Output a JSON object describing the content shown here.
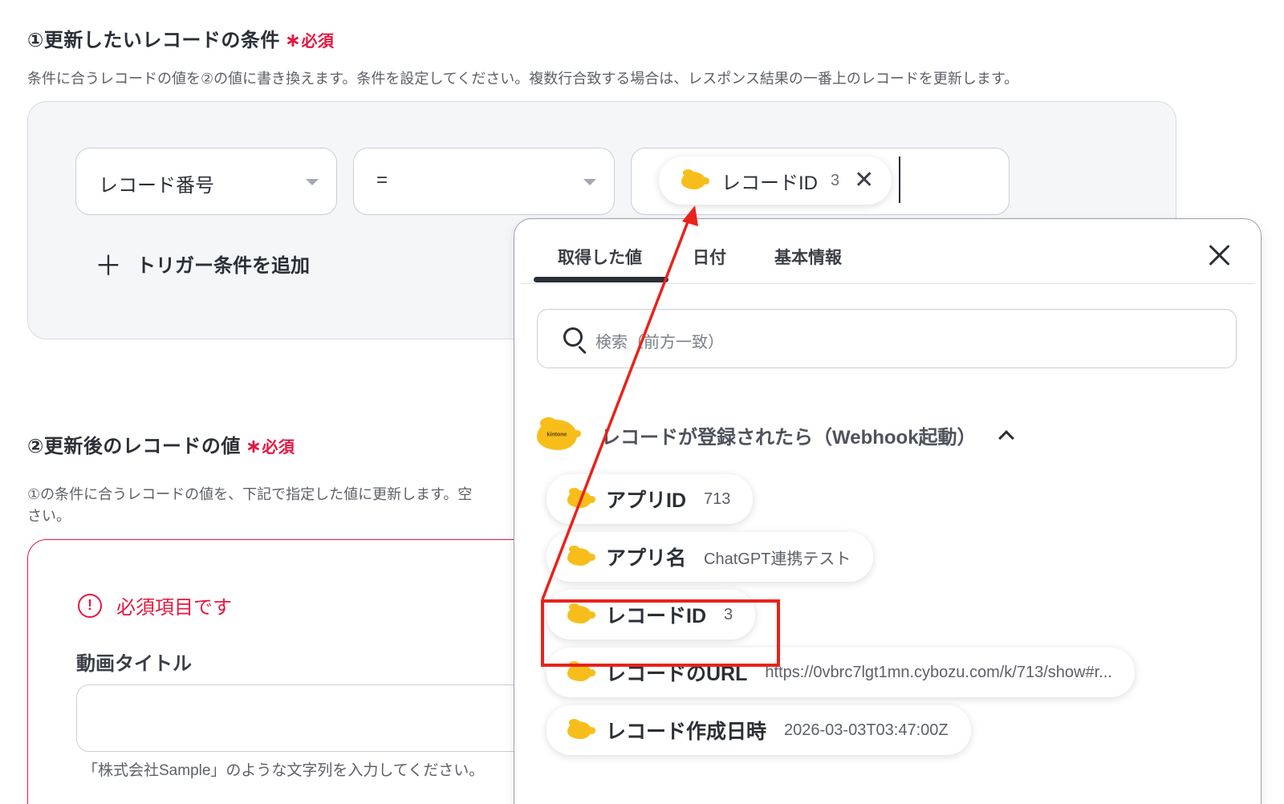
{
  "section1": {
    "title": "①更新したいレコードの条件",
    "required_star": "∗",
    "required_label": "必須",
    "description": "条件に合うレコードの値を②の値に書き換えます。条件を設定してください。複数行合致する場合は、レスポンス結果の一番上のレコードを更新します。",
    "field_select": "レコード番号",
    "operator_select": "=",
    "value_chip": {
      "label": "レコードID",
      "value": "3"
    },
    "add_condition": "トリガー条件を追加"
  },
  "section2": {
    "title": "②更新後のレコードの値",
    "required_star": "∗",
    "required_label": "必須",
    "description_line1": "①の条件に合うレコードの値を、下記で指定した値に更新します。空",
    "description_line2": "さい。",
    "error_text": "必須項目です",
    "field_label": "動画タイトル",
    "field_hint": "「株式会社Sample」のような文字列を入力してください。"
  },
  "popup": {
    "tabs": [
      "取得した値",
      "日付",
      "基本情報"
    ],
    "active_tab": 0,
    "search_placeholder": "検索（前方一致）",
    "group_title": "レコードが登録されたら（Webhook起動）",
    "logo_text": "kintone",
    "items": [
      {
        "name": "アプリID",
        "value": "713"
      },
      {
        "name": "アプリ名",
        "value": "ChatGPT連携テスト"
      },
      {
        "name": "レコードID",
        "value": "3"
      },
      {
        "name": "レコードのURL",
        "value": "https://0vbrc7lgt1mn.cybozu.com/k/713/show#r..."
      },
      {
        "name": "レコード作成日時",
        "value": "2026-03-03T03:47:00Z"
      }
    ]
  },
  "colors": {
    "required": "#e5173f",
    "annotation": "#e8231b",
    "kintone": "#f7be1b"
  },
  "icons": [
    "chevron-down-icon",
    "plus-icon",
    "close-icon",
    "search-icon",
    "chevron-up-icon",
    "alert-circle-icon",
    "kintone-logo-icon"
  ]
}
